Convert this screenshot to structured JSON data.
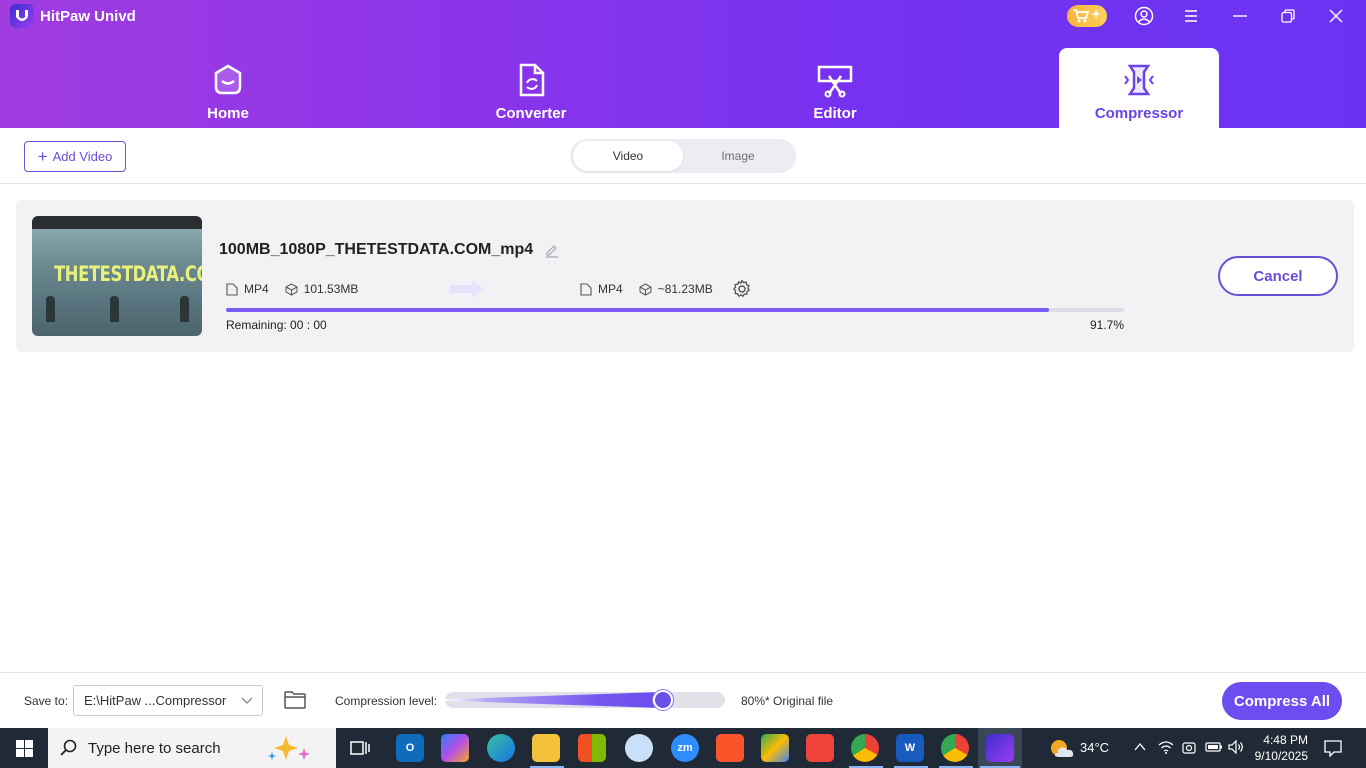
{
  "app": {
    "title": "HitPaw Univd"
  },
  "nav": {
    "tabs": [
      {
        "label": "Home"
      },
      {
        "label": "Converter"
      },
      {
        "label": "Editor"
      },
      {
        "label": "Compressor"
      }
    ],
    "active": "Compressor"
  },
  "toolbar": {
    "add_video_label": "Add Video",
    "segments": [
      {
        "label": "Video",
        "active": true
      },
      {
        "label": "Image",
        "active": false
      }
    ]
  },
  "file": {
    "name": "100MB_1080P_THETESTDATA.COM_mp4",
    "thumbnail_text": "THETESTDATA.COM",
    "source": {
      "format": "MP4",
      "size": "101.53MB"
    },
    "target": {
      "format": "MP4",
      "size": "~81.23MB"
    },
    "progress_fraction": 0.917,
    "remaining_label": "Remaining: 00 : 00",
    "percent_label": "91.7%",
    "cancel_label": "Cancel"
  },
  "footer": {
    "save_to_label": "Save to:",
    "save_path": "E:\\HitPaw ...Compressor",
    "compression_label": "Compression level:",
    "compression_fraction": 0.78,
    "compression_value": "80%* Original file",
    "compress_all_label": "Compress All"
  },
  "taskbar": {
    "search_placeholder": "Type here to search",
    "weather": "34°C",
    "time": "4:48 PM",
    "date": "9/10/2025",
    "apps": [
      "task-view",
      "outlook",
      "copilot",
      "edge",
      "file-explorer",
      "microsoft-store",
      "paint",
      "zoom",
      "brave",
      "google-meet",
      "anydesk",
      "chrome-h",
      "word",
      "chrome-z",
      "hitpaw"
    ],
    "zoom_label": "zm"
  },
  "colors": {
    "accent": "#6b4df0",
    "header_start": "#a03ce0",
    "header_end": "#6a33f2",
    "progress": "#7b5cf2"
  }
}
